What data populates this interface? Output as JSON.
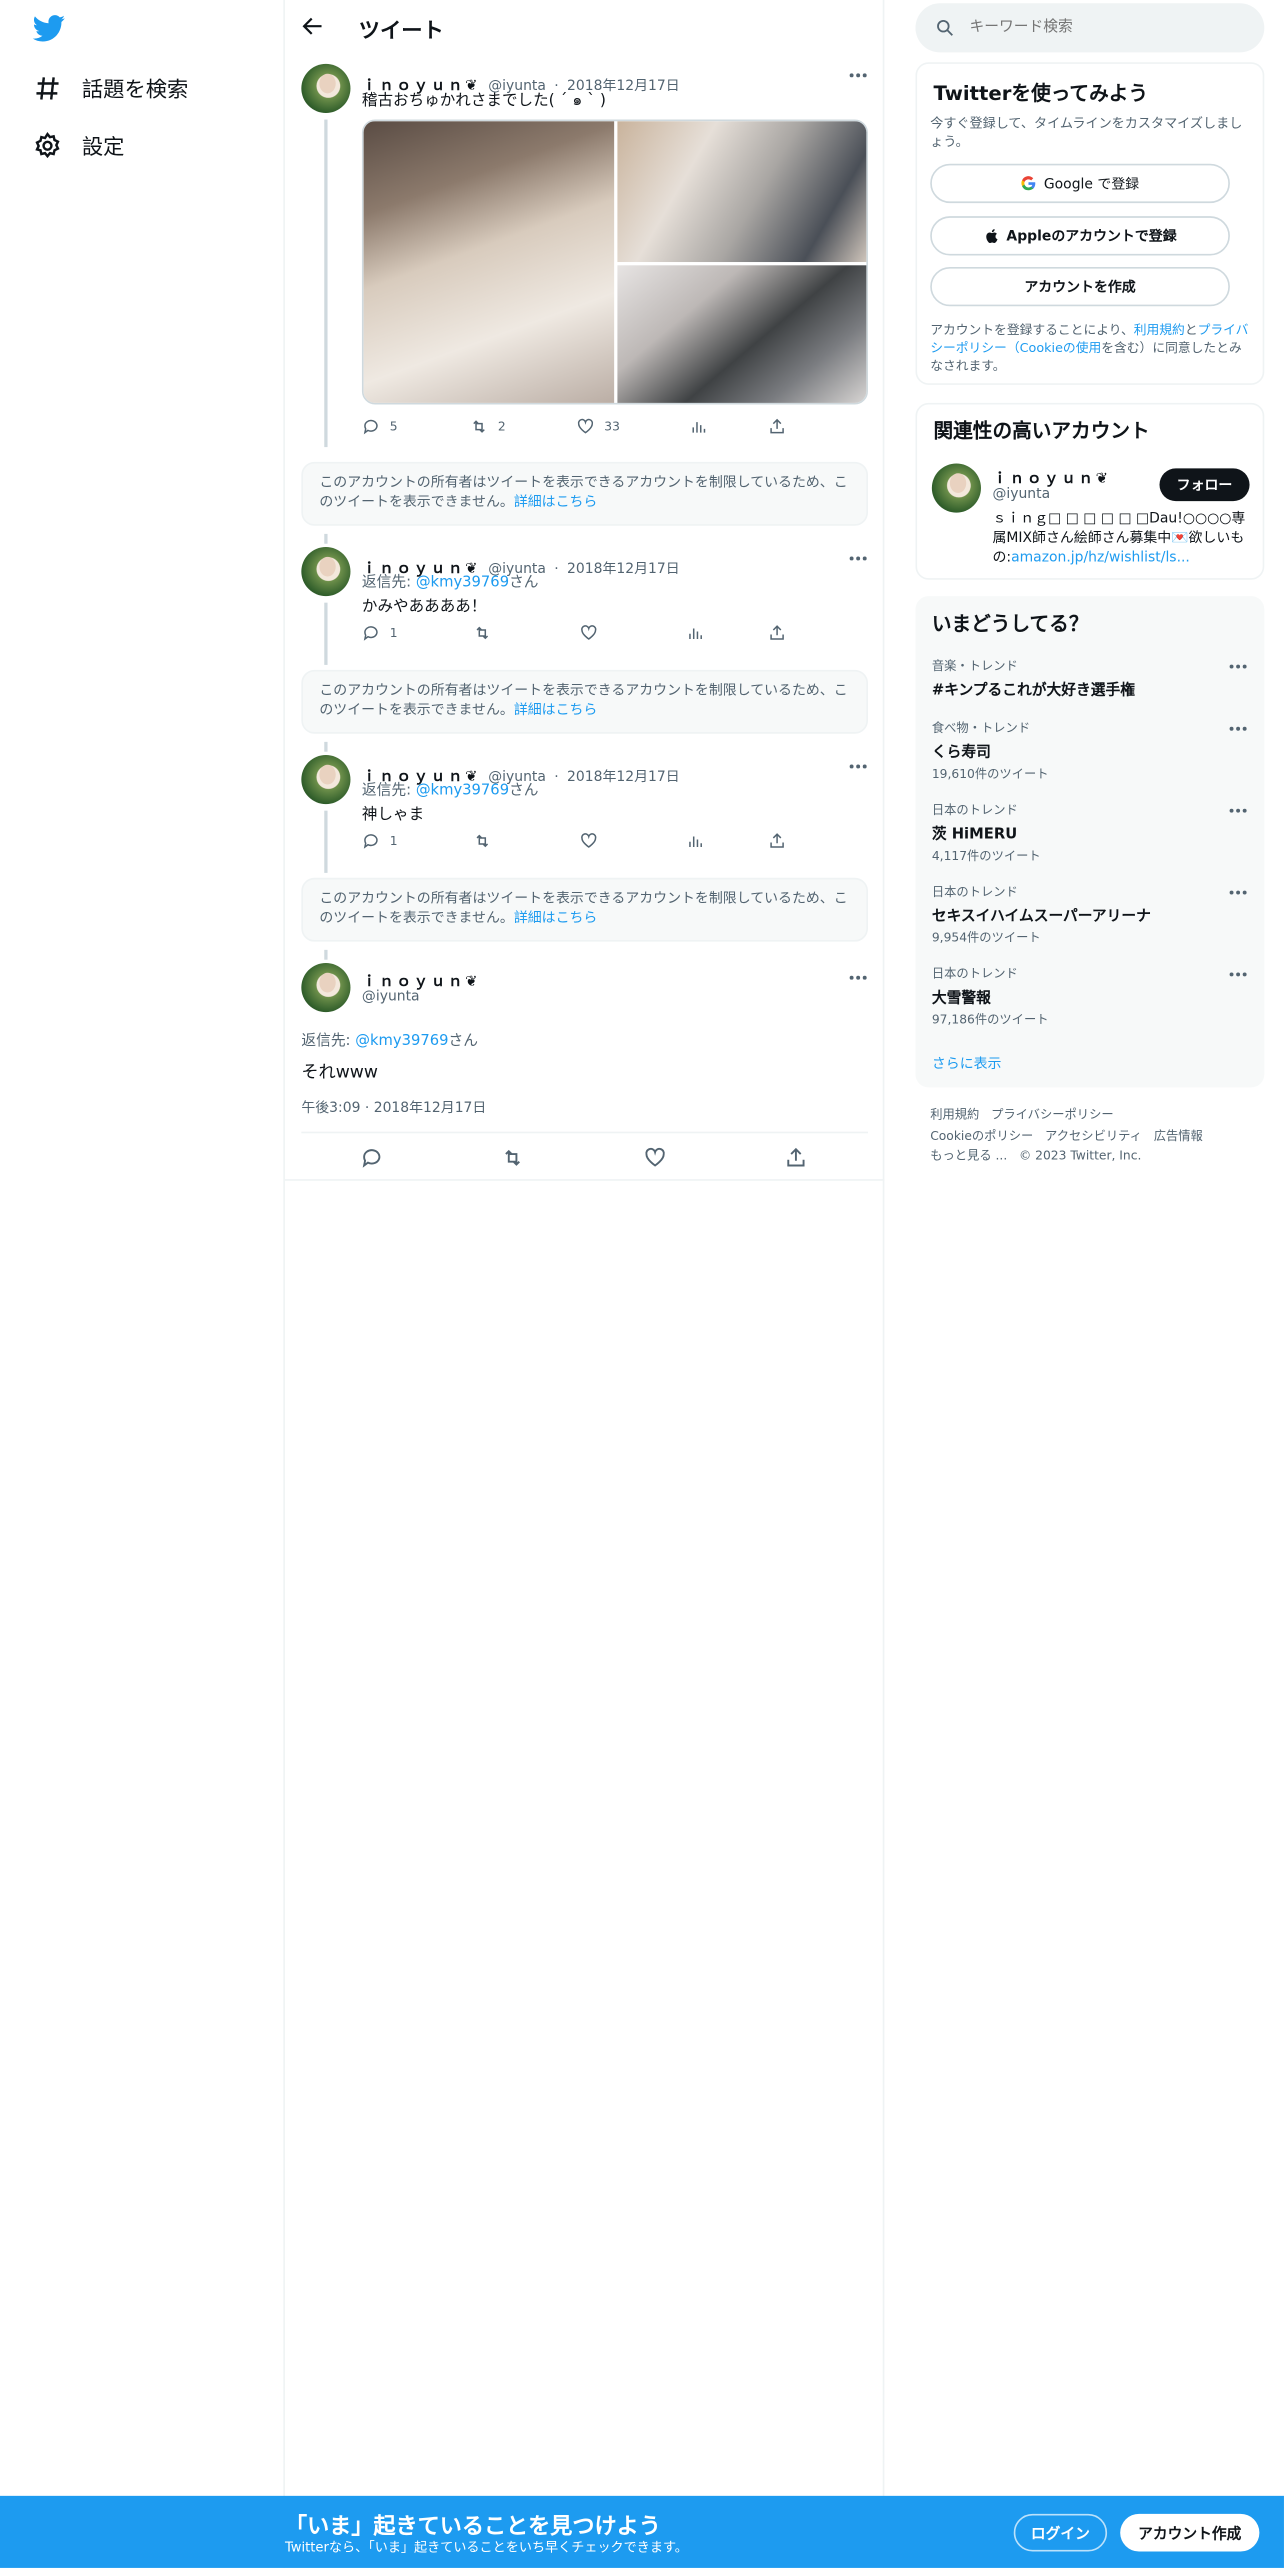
{
  "nav": {
    "explore_label": "話題を検索",
    "settings_label": "設定"
  },
  "header": {
    "title": "ツイート"
  },
  "tweets": [
    {
      "name": "ｉｎｏｙｕｎ❦",
      "handle": "@iyunta",
      "date": "2018年12月17日",
      "text": "稽古おちゅかれさまでした( ´ ๑ ` )",
      "replies": "5",
      "retweets": "2",
      "likes": "33"
    },
    {
      "name": "ｉｎｏｙｕｎ❦",
      "handle": "@iyunta",
      "date": "2018年12月17日",
      "reply_prefix": "返信先: ",
      "reply_to": "@kmy39769",
      "reply_suffix": "さん",
      "text": "かみやああああ！",
      "replies": "1"
    },
    {
      "name": "ｉｎｏｙｕｎ❦",
      "handle": "@iyunta",
      "date": "2018年12月17日",
      "reply_prefix": "返信先: ",
      "reply_to": "@kmy39769",
      "reply_suffix": "さん",
      "text": "神しゃま",
      "replies": "1"
    }
  ],
  "notice": {
    "text": "このアカウントの所有者はツイートを表示できるアカウントを制限しているため、このツイートを表示できません。",
    "link": "詳細はこちら"
  },
  "focus": {
    "name": "ｉｎｏｙｕｎ❦",
    "handle": "@iyunta",
    "reply_prefix": "返信先: ",
    "reply_to": "@kmy39769",
    "reply_suffix": "さん",
    "text": "それwww",
    "timestamp": "午後3:09 · 2018年12月17日"
  },
  "sidebar": {
    "search_placeholder": "キーワード検索",
    "signup": {
      "title": "Twitterを使ってみよう",
      "subtitle": "今すぐ登録して、タイムラインをカスタマイズしましょう。",
      "google_label": "Google で登録",
      "apple_label": "Appleのアカウントで登録",
      "create_label": "アカウントを作成",
      "legal_1": "アカウントを登録することにより、",
      "terms": "利用規約",
      "legal_2": "と",
      "privacy": "プライバシーポリシー（Cookieの使用",
      "legal_3": "を含む）に同意したとみなされます。"
    },
    "related": {
      "title": "関連性の高いアカウント",
      "name": "ｉｎｏｙｕｎ❦",
      "handle": "@iyunta",
      "follow_label": "フォロー",
      "bio": "ｓｉｎｇ□ □ □ □ □ □Dau!○○○○専属MIX師さん絵師さん募集中💌欲しいもの:",
      "bio_link": "amazon.jp/hz/wishlist/ls..."
    },
    "trends": {
      "title": "いまどうしてる？",
      "items": [
        {
          "context": "音楽・トレンド",
          "name": "#キンプるこれが大好き選手権",
          "count": ""
        },
        {
          "context": "食べ物・トレンド",
          "name": "くら寿司",
          "count": "19,610件のツイート"
        },
        {
          "context": "日本のトレンド",
          "name": "茨 HiMERU",
          "count": "4,117件のツイート"
        },
        {
          "context": "日本のトレンド",
          "name": "セキスイハイムスーパーアリーナ",
          "count": "9,954件のツイート"
        },
        {
          "context": "日本のトレンド",
          "name": "大雪警報",
          "count": "97,186件のツイート"
        }
      ],
      "show_more": "さらに表示"
    },
    "footer_links": {
      "terms": "利用規約",
      "privacy": "プライバシーポリシー",
      "cookie": "Cookieのポリシー",
      "accessibility": "アクセシビリティ",
      "ads": "広告情報",
      "more": "もっと見る ...",
      "copyright": "© 2023 Twitter, Inc."
    }
  },
  "bottom_bar": {
    "title": "「いま」起きていることを見つけよう",
    "subtitle": "Twitterなら、「いま」起きていることをいち早くチェックできます。",
    "login_label": "ログイン",
    "signup_label": "アカウント作成"
  },
  "colors": {
    "accent": "#1d9bf0",
    "text": "#0f1419",
    "muted": "#536471"
  }
}
